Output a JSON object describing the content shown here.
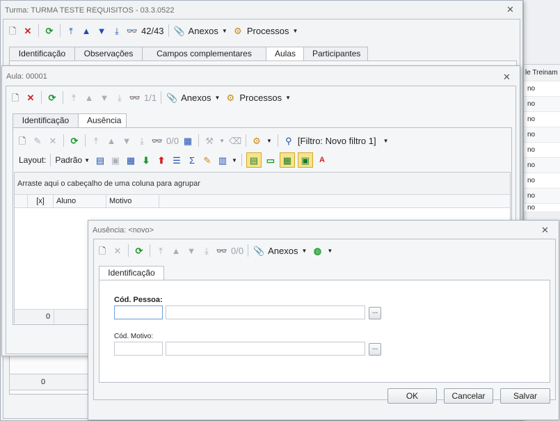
{
  "bg_grid": {
    "header": "le Treinam",
    "rows": [
      "no",
      "no",
      "no",
      "no",
      "no",
      "no",
      "no",
      "no",
      "no"
    ]
  },
  "turma": {
    "title": "Turma: TURMA TESTE REQUISITOS - 03.3.0522",
    "toolbar": {
      "record_counter": "42/43",
      "attachments_label": "Anexos",
      "processes_label": "Processos"
    },
    "tabs": [
      "Identificação",
      "Observações",
      "Campos complementares",
      "Aulas",
      "Participantes"
    ],
    "footer_count": "0"
  },
  "aula": {
    "title": "Aula: 00001",
    "toolbar": {
      "record_counter": "1/1",
      "attachments_label": "Anexos",
      "processes_label": "Processos"
    },
    "tabs": [
      "Identificação",
      "Ausência"
    ],
    "sub_toolbar": {
      "record_counter": "0/0",
      "filter_label": "[Filtro: Novo filtro 1]"
    },
    "layout_label": "Layout:",
    "layout_value": "Padrão",
    "group_hint": "Arraste aqui o cabeçalho de uma coluna para agrupar",
    "columns": [
      "[x]",
      "Aluno",
      "Motivo"
    ],
    "footer_count": "0"
  },
  "ausencia": {
    "title": "Ausência: <novo>",
    "toolbar": {
      "record_counter": "0/0",
      "attachments_label": "Anexos"
    },
    "tab": "Identificação",
    "cod_pessoa_label": "Cód. Pessoa:",
    "cod_motivo_label": "Cód. Motivo:",
    "lookup_button": "...",
    "buttons": {
      "ok": "OK",
      "cancel": "Cancelar",
      "save": "Salvar"
    }
  },
  "icons": {
    "new": "new-document-icon",
    "delete": "delete-icon",
    "refresh": "refresh-icon",
    "first": "first-record-icon",
    "prev": "previous-record-icon",
    "next": "next-record-icon",
    "last": "last-record-icon",
    "find": "binoculars-icon",
    "attach": "paperclip-icon",
    "process": "gears-icon"
  },
  "colors": {
    "accent_blue": "#1c4fb0",
    "delete_red": "#d21f1f",
    "refresh_green": "#1b9a2b",
    "highlight": "#f7e48a"
  }
}
